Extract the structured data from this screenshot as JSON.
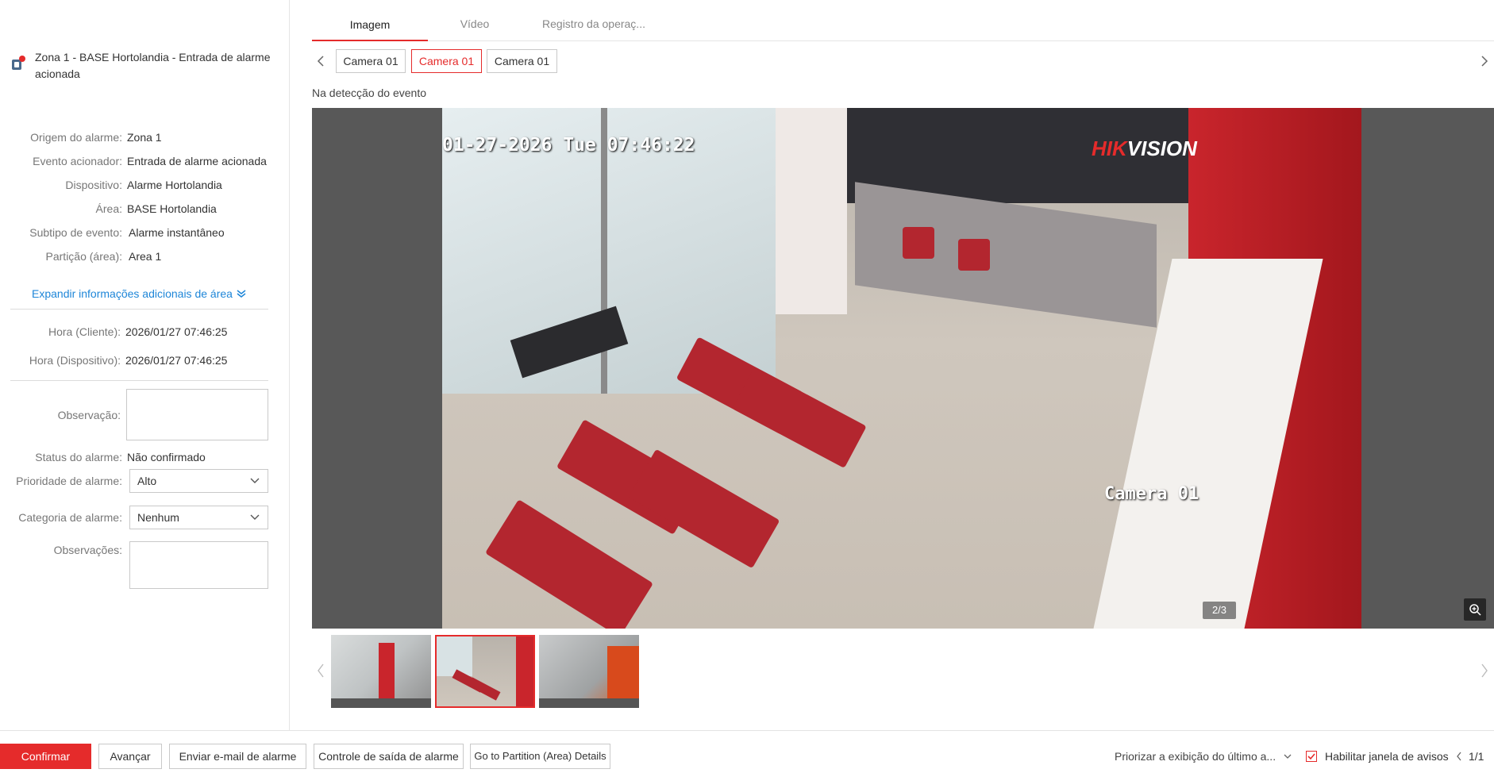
{
  "alarm": {
    "title": "Zona 1 - BASE Hortolandia - Entrada de alarme acionada",
    "icon": "alarm-input-icon"
  },
  "details": [
    {
      "label": "Origem do alarme:",
      "value": "Zona 1"
    },
    {
      "label": "Evento acionador:",
      "value": "Entrada de alarme acionada"
    },
    {
      "label": "Dispositivo:",
      "value": "Alarme Hortolandia"
    },
    {
      "label": "Área:",
      "value": "BASE Hortolandia"
    },
    {
      "label": "Subtipo de evento:",
      "value": "Alarme instantâneo"
    },
    {
      "label": "Partição (área):",
      "value": "Area 1"
    }
  ],
  "expand_label": "Expandir informações adicionais de área",
  "times": [
    {
      "label": "Hora (Cliente):",
      "value": "2026/01/27 07:46:25"
    },
    {
      "label": "Hora (Dispositivo):",
      "value": "2026/01/27 07:46:25"
    }
  ],
  "form": {
    "observacao_label": "Observação:",
    "status_label": "Status do alarme:",
    "status_value": "Não confirmado",
    "priority_label": "Prioridade de alarme:",
    "priority_value": "Alto",
    "category_label": "Categoria de alarme:",
    "category_value": "Nenhum",
    "observacoes_label": "Observações:"
  },
  "tabs": [
    "Imagem",
    "Vídeo",
    "Registro da operaç..."
  ],
  "cameras": [
    "Camera 01",
    "Camera 01",
    "Camera 01"
  ],
  "event_label": "Na detecção do evento",
  "viewer": {
    "timestamp": "01-27-2026 Tue 07:46:22",
    "brand_a": "HIK",
    "brand_b": "VISION",
    "camera_name": "Camera 01",
    "counter": "2/3"
  },
  "bottom": {
    "confirm": "Confirmar",
    "next": "Avançar",
    "email": "Enviar e-mail de alarme",
    "output": "Controle de saída de alarme",
    "partition": "Go to Partition (Area) Details",
    "priority_display": "Priorizar a exibição do último a...",
    "enable_window": "Habilitar janela de avisos",
    "page": "1/1"
  },
  "colors": {
    "accent": "#e52b2b",
    "link": "#1e86d8"
  }
}
